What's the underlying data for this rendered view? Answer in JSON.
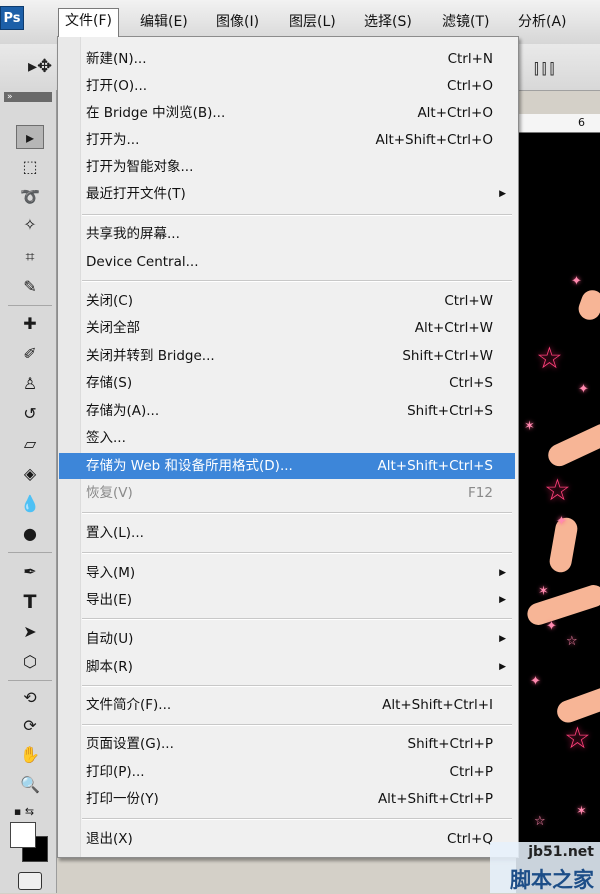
{
  "app": {
    "logo": "Ps"
  },
  "menubar": [
    {
      "label": "文件(F)",
      "active": true
    },
    {
      "label": "编辑(E)"
    },
    {
      "label": "图像(I)"
    },
    {
      "label": "图层(L)"
    },
    {
      "label": "选择(S)"
    },
    {
      "label": "滤镜(T)"
    },
    {
      "label": "分析(A)"
    }
  ],
  "options_bar": {
    "tool_icon": "move-tool-icon",
    "align_icons": "align-icons"
  },
  "ruler": {
    "tick": "6"
  },
  "file_menu": {
    "items": [
      {
        "label": "新建(N)...",
        "shortcut": "Ctrl+N"
      },
      {
        "label": "打开(O)...",
        "shortcut": "Ctrl+O"
      },
      {
        "label": "在 Bridge 中浏览(B)...",
        "shortcut": "Alt+Ctrl+O"
      },
      {
        "label": "打开为...",
        "shortcut": "Alt+Shift+Ctrl+O"
      },
      {
        "label": "打开为智能对象..."
      },
      {
        "label": "最近打开文件(T)",
        "submenu": true
      },
      {
        "label": "共享我的屏幕..."
      },
      {
        "label": "Device Central..."
      },
      {
        "label": "关闭(C)",
        "shortcut": "Ctrl+W"
      },
      {
        "label": "关闭全部",
        "shortcut": "Alt+Ctrl+W"
      },
      {
        "label": "关闭并转到 Bridge...",
        "shortcut": "Shift+Ctrl+W"
      },
      {
        "label": "存储(S)",
        "shortcut": "Ctrl+S"
      },
      {
        "label": "存储为(A)...",
        "shortcut": "Shift+Ctrl+S"
      },
      {
        "label": "签入..."
      },
      {
        "label": "存储为 Web 和设备所用格式(D)...",
        "shortcut": "Alt+Shift+Ctrl+S",
        "highlighted": true
      },
      {
        "label": "恢复(V)",
        "shortcut": "F12",
        "disabled": true
      },
      {
        "label": "置入(L)..."
      },
      {
        "label": "导入(M)",
        "submenu": true
      },
      {
        "label": "导出(E)",
        "submenu": true
      },
      {
        "label": "自动(U)",
        "submenu": true
      },
      {
        "label": "脚本(R)",
        "submenu": true
      },
      {
        "label": "文件简介(F)...",
        "shortcut": "Alt+Shift+Ctrl+I"
      },
      {
        "label": "页面设置(G)...",
        "shortcut": "Shift+Ctrl+P"
      },
      {
        "label": "打印(P)...",
        "shortcut": "Ctrl+P"
      },
      {
        "label": "打印一份(Y)",
        "shortcut": "Alt+Shift+Ctrl+P"
      },
      {
        "label": "退出(X)",
        "shortcut": "Ctrl+Q"
      }
    ]
  },
  "watermark": {
    "url": "jb51.net",
    "name": "脚本之家"
  },
  "colors": {
    "highlight": "#3d86d9",
    "disabled": "#8a8a8a",
    "star": "#ff3f7a",
    "stroke": "#f7b596"
  }
}
